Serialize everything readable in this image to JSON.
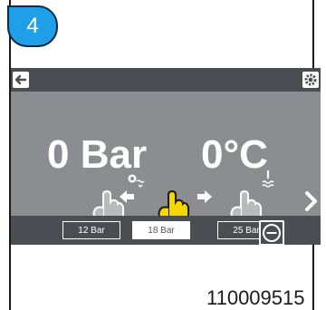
{
  "step": {
    "number": "4"
  },
  "display": {
    "pressure_value": "0 Bar",
    "temperature_value": "0°C"
  },
  "presets": [
    "12 Bar",
    "18 Bar",
    "25 Bar"
  ],
  "selected_preset": "18 Bar",
  "colors": {
    "badge": "#1e9fe8",
    "screen": "#8b8d90",
    "bar": "#4a4d51",
    "highlight_hand": "#f5d800",
    "hand": "#b9babc"
  },
  "icons": [
    "back-arrow-icon",
    "settings-gear-icon",
    "minus-circle-icon",
    "chevron-right-icon",
    "pump-icon",
    "water-heater-icon",
    "arrow-left-icon",
    "arrow-right-icon",
    "pointing-hand-icon"
  ],
  "footer": {
    "model_number": "110009515"
  }
}
